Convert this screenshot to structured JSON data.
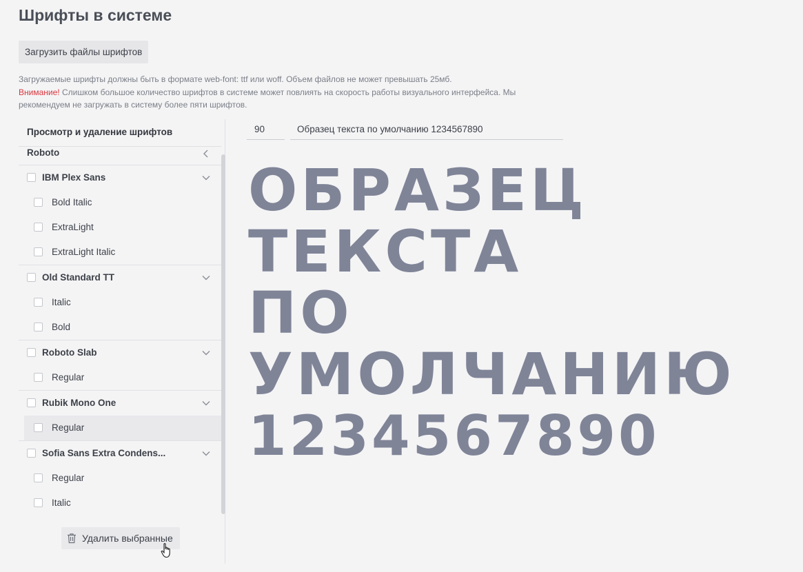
{
  "page": {
    "title": "Шрифты в системе",
    "upload_label": "Загрузить файлы шрифтов",
    "note_line1": "Загружаемые шрифты должны быть в формате web-font: ttf или woff. Объем файлов не может превышать 25мб.",
    "warning_label": "Внимание!",
    "warning_text": " Слишком большое количество шрифтов в системе может повлиять на скорость работы визуального интерфейса. Мы рекомендуем не загружать в систему более пяти шрифтов."
  },
  "left_panel": {
    "title": "Просмотр и удаление шрифтов",
    "selected_font": "Roboto",
    "families": [
      {
        "name": "IBM Plex Sans",
        "styles": [
          "Bold Italic",
          "ExtraLight",
          "ExtraLight Italic"
        ]
      },
      {
        "name": "Old Standard TT",
        "styles": [
          "Italic",
          "Bold"
        ]
      },
      {
        "name": "Roboto Slab",
        "styles": [
          "Regular"
        ]
      },
      {
        "name": "Rubik Mono One",
        "styles": [
          "Regular"
        ]
      },
      {
        "name": "Sofia Sans Extra Condens...",
        "styles": [
          "Regular",
          "Italic"
        ]
      }
    ],
    "delete_label": "Удалить выбранные"
  },
  "preview": {
    "size_value": "90",
    "sample_text": "Образец текста по умолчанию 1234567890",
    "lines": [
      "ОБРАЗЕЦ",
      "ТЕКСТА",
      "ПО",
      "УМОЛЧАНИЮ",
      "1234567890"
    ],
    "text_color": "#7f8497"
  },
  "icons": {
    "collapse": "chevron-left-icon",
    "expand": "chevron-down-icon",
    "delete": "trash-icon",
    "pointer": "hand-cursor-icon"
  },
  "colors": {
    "warning": "#d9363e",
    "background": "#f4f4f5"
  }
}
